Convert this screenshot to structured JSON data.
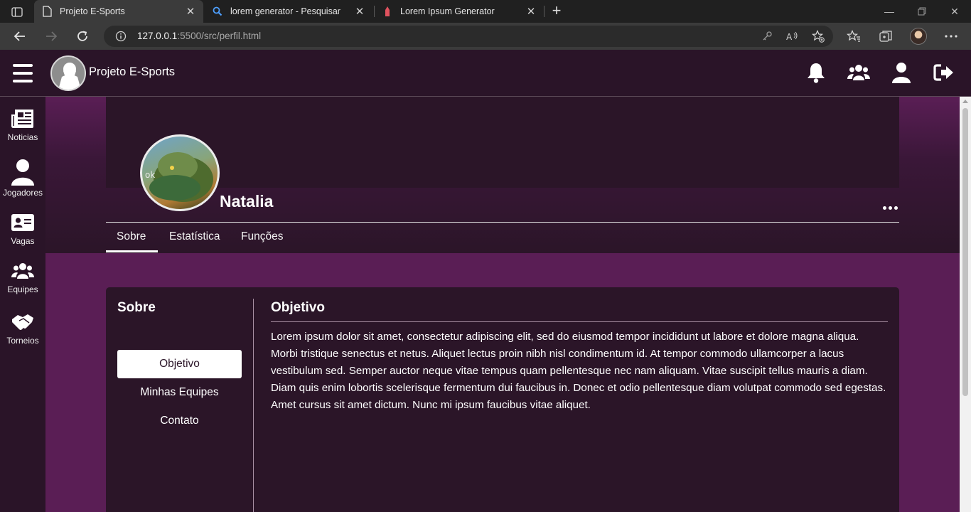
{
  "browser": {
    "tabs": [
      {
        "title": "Projeto E-Sports",
        "favicon": "page-icon",
        "active": true
      },
      {
        "title": "lorem generator - Pesquisar",
        "favicon": "bing-search-icon",
        "active": false
      },
      {
        "title": "Lorem Ipsum Generator",
        "favicon": "lipstick-icon",
        "active": false
      }
    ],
    "url_host": "127.0.0.1",
    "url_rest": ":5500/src/perfil.html"
  },
  "header": {
    "brand": "Projeto E-Sports",
    "icons": [
      "bell-icon",
      "users-icon",
      "user-icon",
      "logout-icon"
    ]
  },
  "sidebar": {
    "items": [
      {
        "label": "Noticias",
        "icon": "newspaper-icon"
      },
      {
        "label": "Jogadores",
        "icon": "user-icon"
      },
      {
        "label": "Vagas",
        "icon": "id-card-icon"
      },
      {
        "label": "Equipes",
        "icon": "users-icon"
      },
      {
        "label": "Torneios",
        "icon": "handshake-icon"
      }
    ]
  },
  "profile": {
    "name": "Natalia",
    "tabs": [
      "Sobre",
      "Estatística",
      "Funções"
    ],
    "active_tab": "Sobre"
  },
  "about": {
    "side_title": "Sobre",
    "menu": [
      "Objetivo",
      "Minhas Equipes",
      "Contato"
    ],
    "active_menu": "Objetivo",
    "section_title": "Objetivo",
    "text": "Lorem ipsum dolor sit amet, consectetur adipiscing elit, sed do eiusmod tempor incididunt ut labore et dolore magna aliqua. Morbi tristique senectus et netus. Aliquet lectus proin nibh nisl condimentum id. At tempor commodo ullamcorper a lacus vestibulum sed. Semper auctor neque vitae tempus quam pellentesque nec nam aliquam. Vitae suscipit tellus mauris a diam. Diam quis enim lobortis scelerisque fermentum dui faucibus in. Donec et odio pellentesque diam volutpat commodo sed egestas. Amet cursus sit amet dictum. Nunc mi ipsum faucibus vitae aliquet."
  },
  "colors": {
    "header_bg": "#2a1428",
    "page_bg": "#5a1e55",
    "card_bg": "#2b1528"
  }
}
